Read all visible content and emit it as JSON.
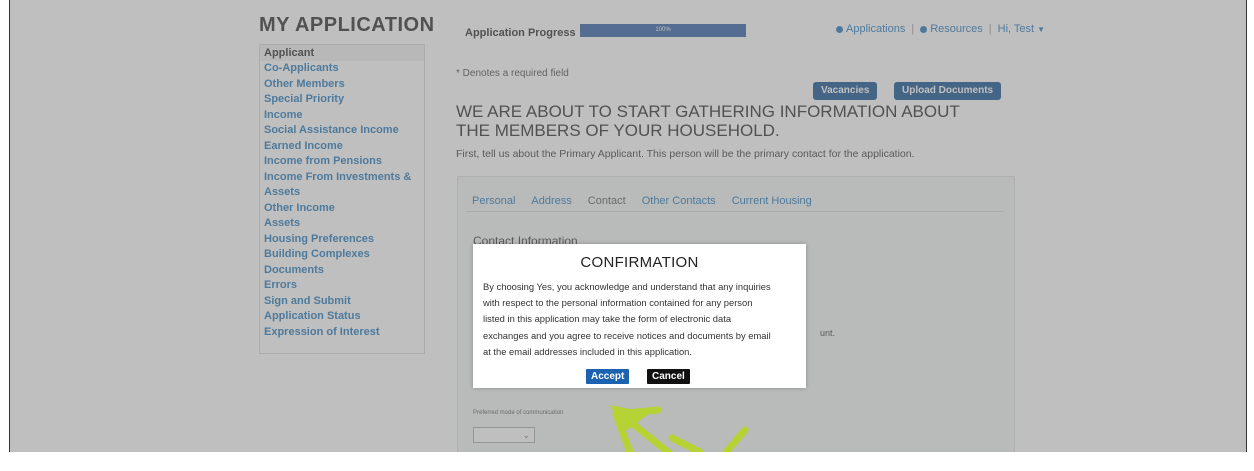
{
  "app": {
    "title": "MY APPLICATION"
  },
  "sidebar": {
    "items": [
      {
        "label": "Applicant"
      },
      {
        "label": "Co-Applicants"
      },
      {
        "label": "Other Members"
      },
      {
        "label": "Special Priority"
      },
      {
        "label": "Income"
      },
      {
        "label": "Social Assistance Income"
      },
      {
        "label": "Earned Income"
      },
      {
        "label": "Income from Pensions"
      },
      {
        "label": "Income From Investments & Assets"
      },
      {
        "label": "Other Income"
      },
      {
        "label": "Assets"
      },
      {
        "label": "Housing Preferences"
      },
      {
        "label": "Building Complexes"
      },
      {
        "label": "Documents"
      },
      {
        "label": "Errors"
      },
      {
        "label": "Sign and Submit"
      },
      {
        "label": "Application Status"
      },
      {
        "label": "Expression of Interest"
      }
    ]
  },
  "progress": {
    "label": "Application Progress",
    "value_text": "100%",
    "fraction": 1.0
  },
  "topnav": {
    "applications": "Applications",
    "resources": "Resources",
    "user": "Hi, Test"
  },
  "main": {
    "required_note": "* Denotes a required field",
    "vacancies_label": "Vacancies",
    "upload_label": "Upload Documents",
    "heading": "WE ARE ABOUT TO START GATHERING INFORMATION ABOUT THE MEMBERS OF YOUR HOUSEHOLD.",
    "intro": "First, tell us about the Primary Applicant. This person will be the primary contact for the application.",
    "tabs": [
      {
        "label": "Personal"
      },
      {
        "label": "Address"
      },
      {
        "label": "Contact"
      },
      {
        "label": "Other Contacts"
      },
      {
        "label": "Current Housing"
      }
    ],
    "section_title": "Contact Information",
    "partial_text": "unt.",
    "preferred_label": "Preferred mode of communication"
  },
  "modal": {
    "title": "CONFIRMATION",
    "lines": [
      "By choosing Yes, you acknowledge and understand that any inquiries",
      "with respect to the personal information contained for any person",
      "listed in this application may take the form of electronic data",
      "exchanges and you agree to receive notices and documents by email",
      "at the email addresses included in this application."
    ],
    "accept_label": "Accept",
    "cancel_label": "Cancel"
  },
  "colors": {
    "accent": "#1a74b8",
    "primary_button": "#0b4a8c",
    "arrow": "#b5d334"
  }
}
